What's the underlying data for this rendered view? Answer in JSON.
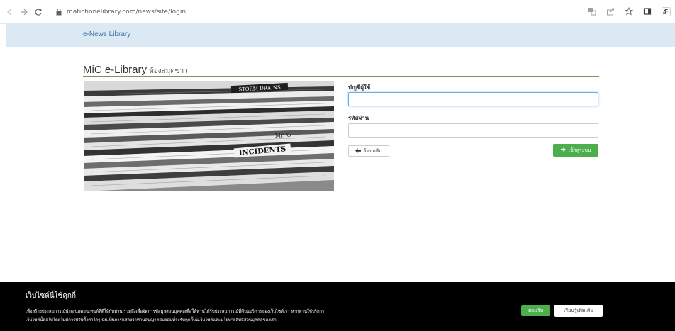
{
  "browser": {
    "url": "matichonelibrary.com/news/site/login",
    "icons": [
      "back-icon",
      "forward-icon",
      "reload-icon",
      "lock-icon",
      "translate-icon",
      "share-icon",
      "star-icon",
      "sidebar-icon",
      "extension-icon"
    ]
  },
  "header": {
    "brand": "e-News Library"
  },
  "page": {
    "title": "MiC e-Library",
    "subtitle": "ห้องสมุดข่าว"
  },
  "hero": {
    "headlines": [
      "STORM DRAINS",
      "INCIDENTS",
      "Mr. G"
    ]
  },
  "form": {
    "username_label": "บัญชีผู้ใช้",
    "username_value": "",
    "password_label": "รหัสผ่าน",
    "password_value": "",
    "back_label": "ย้อนกลับ",
    "login_label": "เข้าสู่ระบบ"
  },
  "cookie": {
    "title": "เว็บไซต์นี้ใช้คุกกี้",
    "line1": "เพื่อสร้างประสบการณ์นำเสนอคอนเทนต์ที่ดีให้กับท่าน รวมถึงเพื่อจัดการข้อมูลส่วนบุคคลเพื่อให้ท่านได้รับประสบการณ์ที่ดีบนบริการของเว็บไซต์เรา หากท่านใช้บริการ",
    "line2": "เว็บไซต์นี้ต่อไปโดยไม่มีการปรับตั้งค่าใดๆ นั่นเป็นการแสดงว่าท่านอนุญาตยินยอมที่จะรับคุกกี้บนเว็บไซต์และนโยบายสิทธิส่วนบุคคลของเรา",
    "accept_label": "ยอมรับ",
    "more_label": "เรียนรู้เพิ่มเติม"
  },
  "colors": {
    "header_band": "#dbe9f4",
    "brand_text": "#3a72a8",
    "login_button": "#4cae4c",
    "cookie_bg": "#000000"
  }
}
